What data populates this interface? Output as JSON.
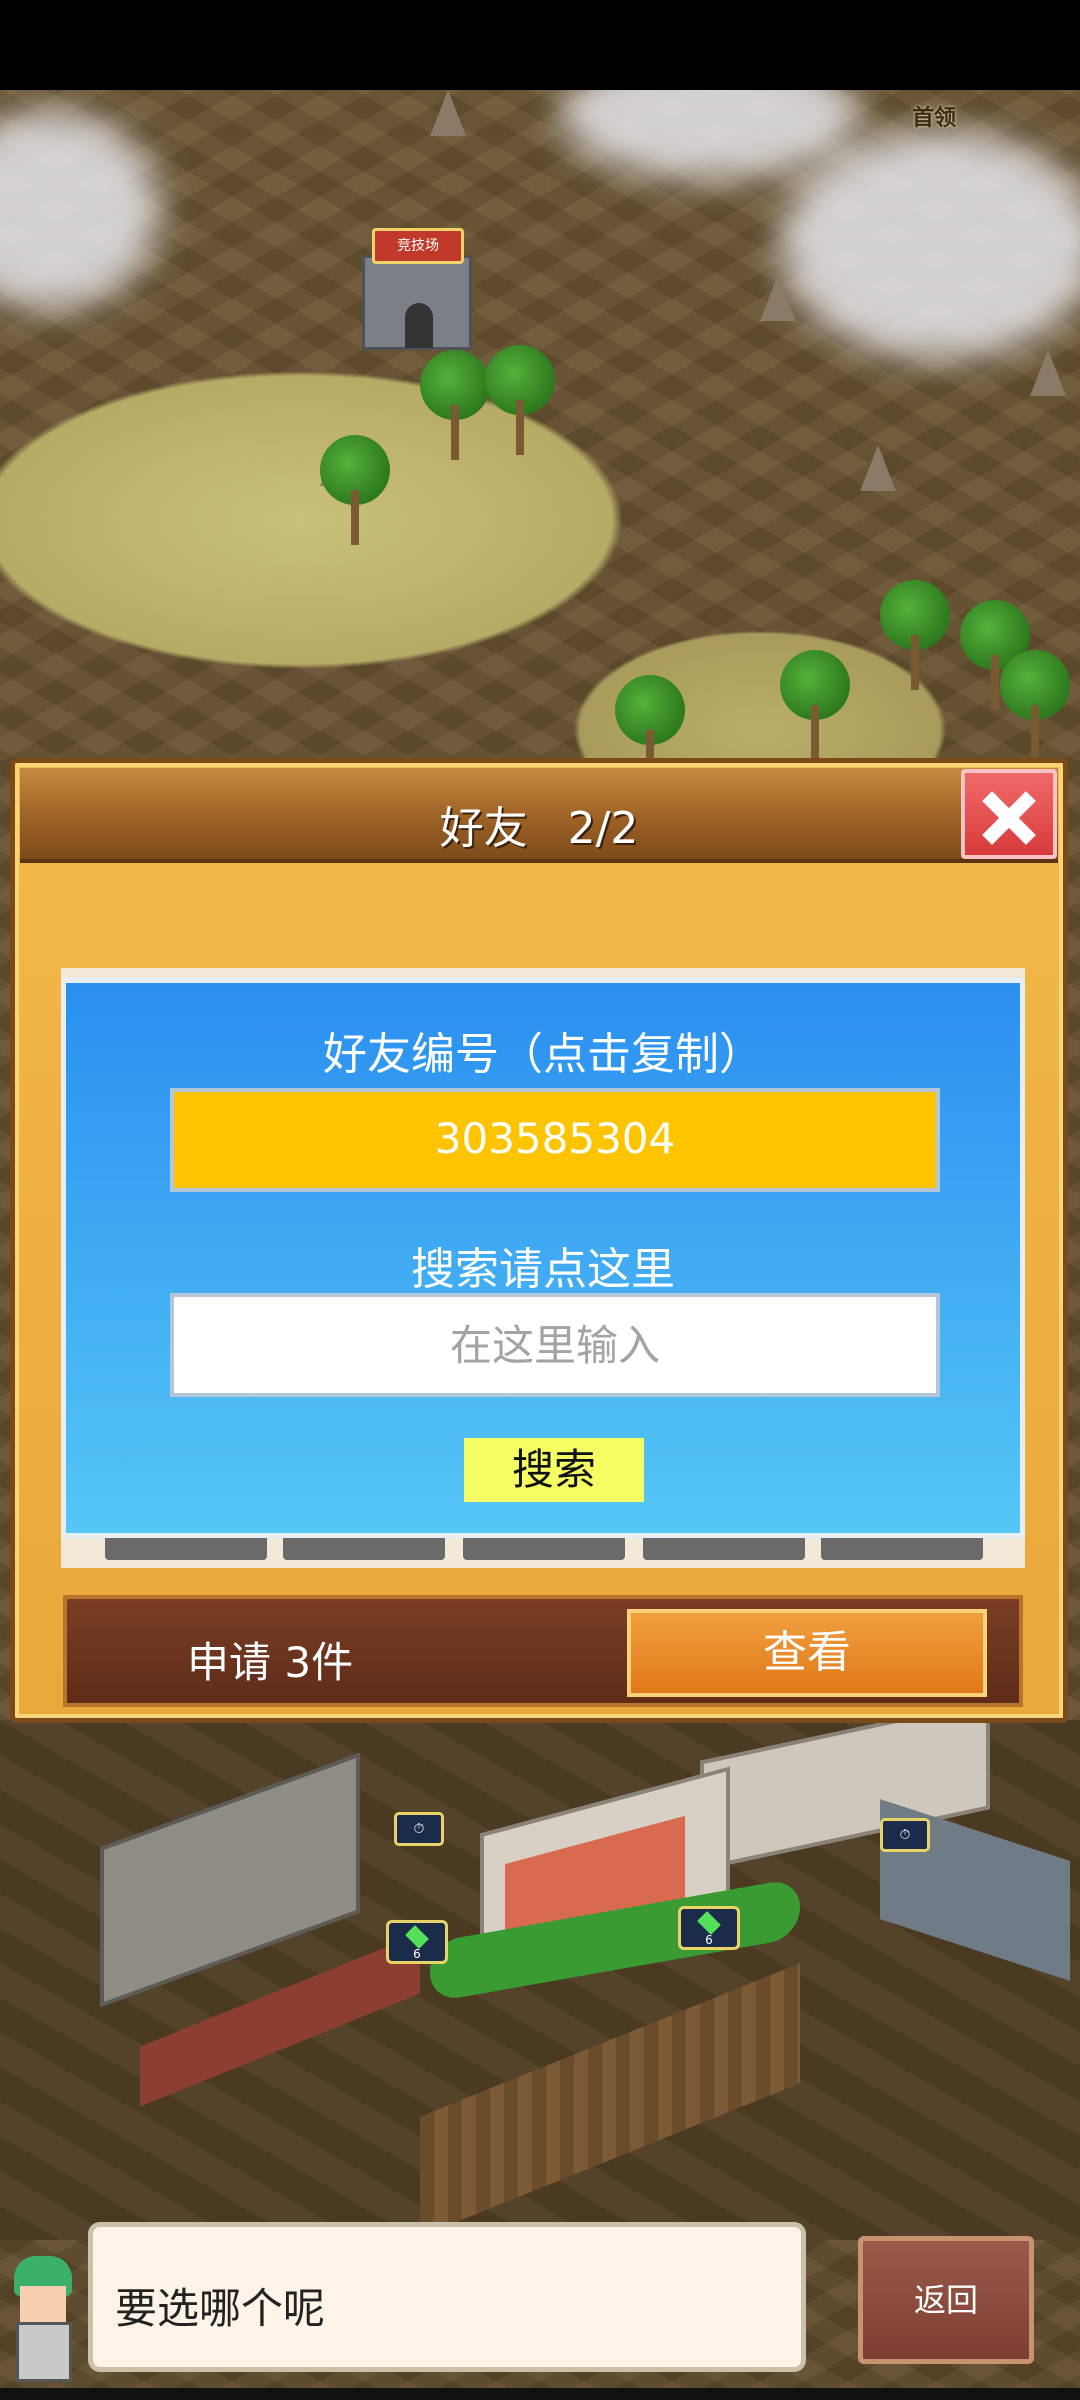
{
  "map": {
    "corner_label": "首领",
    "arena_label": "竞技场",
    "badges": [
      "6",
      "6"
    ]
  },
  "dialog": {
    "title": "好友",
    "page_count": "2/2",
    "friend_id_label": "好友编号（点击复制）",
    "friend_id_value": "303585304",
    "search_label": "搜索请点这里",
    "search_placeholder": "在这里输入",
    "search_button": "搜索",
    "requests_text": "申请 3件",
    "view_button": "查看"
  },
  "bottom": {
    "speech_text": "要选哪个呢",
    "back_button": "返回"
  },
  "colors": {
    "panel_blue": "#2a8ff0",
    "id_box_yellow": "#ffc400",
    "search_button": "#f5ff64",
    "close_red": "#d83a3a",
    "view_orange": "#e07818"
  }
}
